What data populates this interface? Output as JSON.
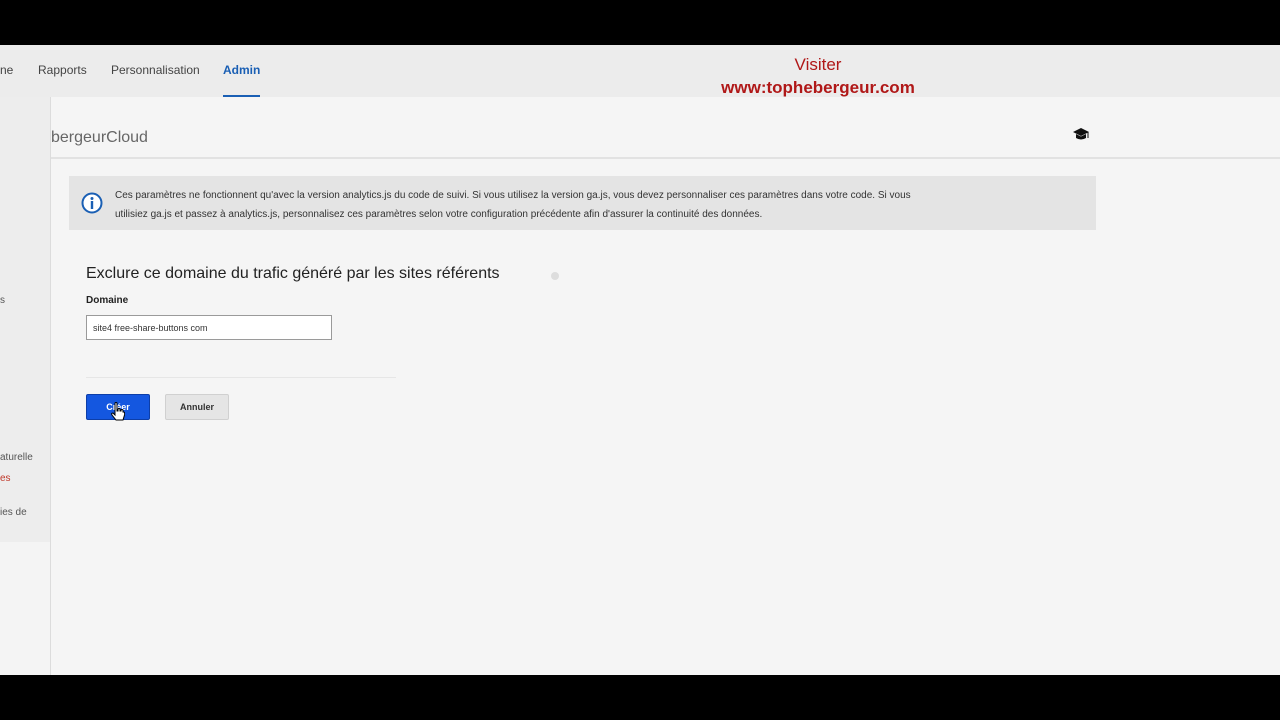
{
  "nav": {
    "tabs": [
      {
        "label": "ne"
      },
      {
        "label": "Rapports"
      },
      {
        "label": "Personnalisation"
      },
      {
        "label": "Admin",
        "active": true
      }
    ]
  },
  "watermark": {
    "line1": "Visiter",
    "line2": "www:tophebergeur.com"
  },
  "account": {
    "name": "bergeurCloud",
    "icon": "graduation-cap-icon"
  },
  "sidebar": {
    "items": [
      {
        "label": "s"
      },
      {
        "label": "aturelle"
      },
      {
        "label": "es",
        "highlight": true
      },
      {
        "label": "ies de"
      }
    ]
  },
  "info": {
    "icon": "info-icon",
    "line1": "Ces paramètres ne fonctionnent qu'avec la version analytics.js du code de suivi. Si vous utilisez la version ga.js, vous devez personnaliser ces paramètres dans votre code. Si vous",
    "line2": "utilisiez ga.js et passez à analytics.js, personnalisez ces paramètres selon votre configuration précédente afin d'assurer la continuité des données."
  },
  "form": {
    "title": "Exclure ce domaine du trafic généré par les sites référents",
    "domain_label": "Domaine",
    "domain_value": "site4 free-share-buttons com",
    "create_label": "Créer",
    "cancel_label": "Annuler"
  },
  "colors": {
    "accent": "#1a5fb4",
    "primary_button": "#1457e0",
    "watermark": "#b01818"
  }
}
